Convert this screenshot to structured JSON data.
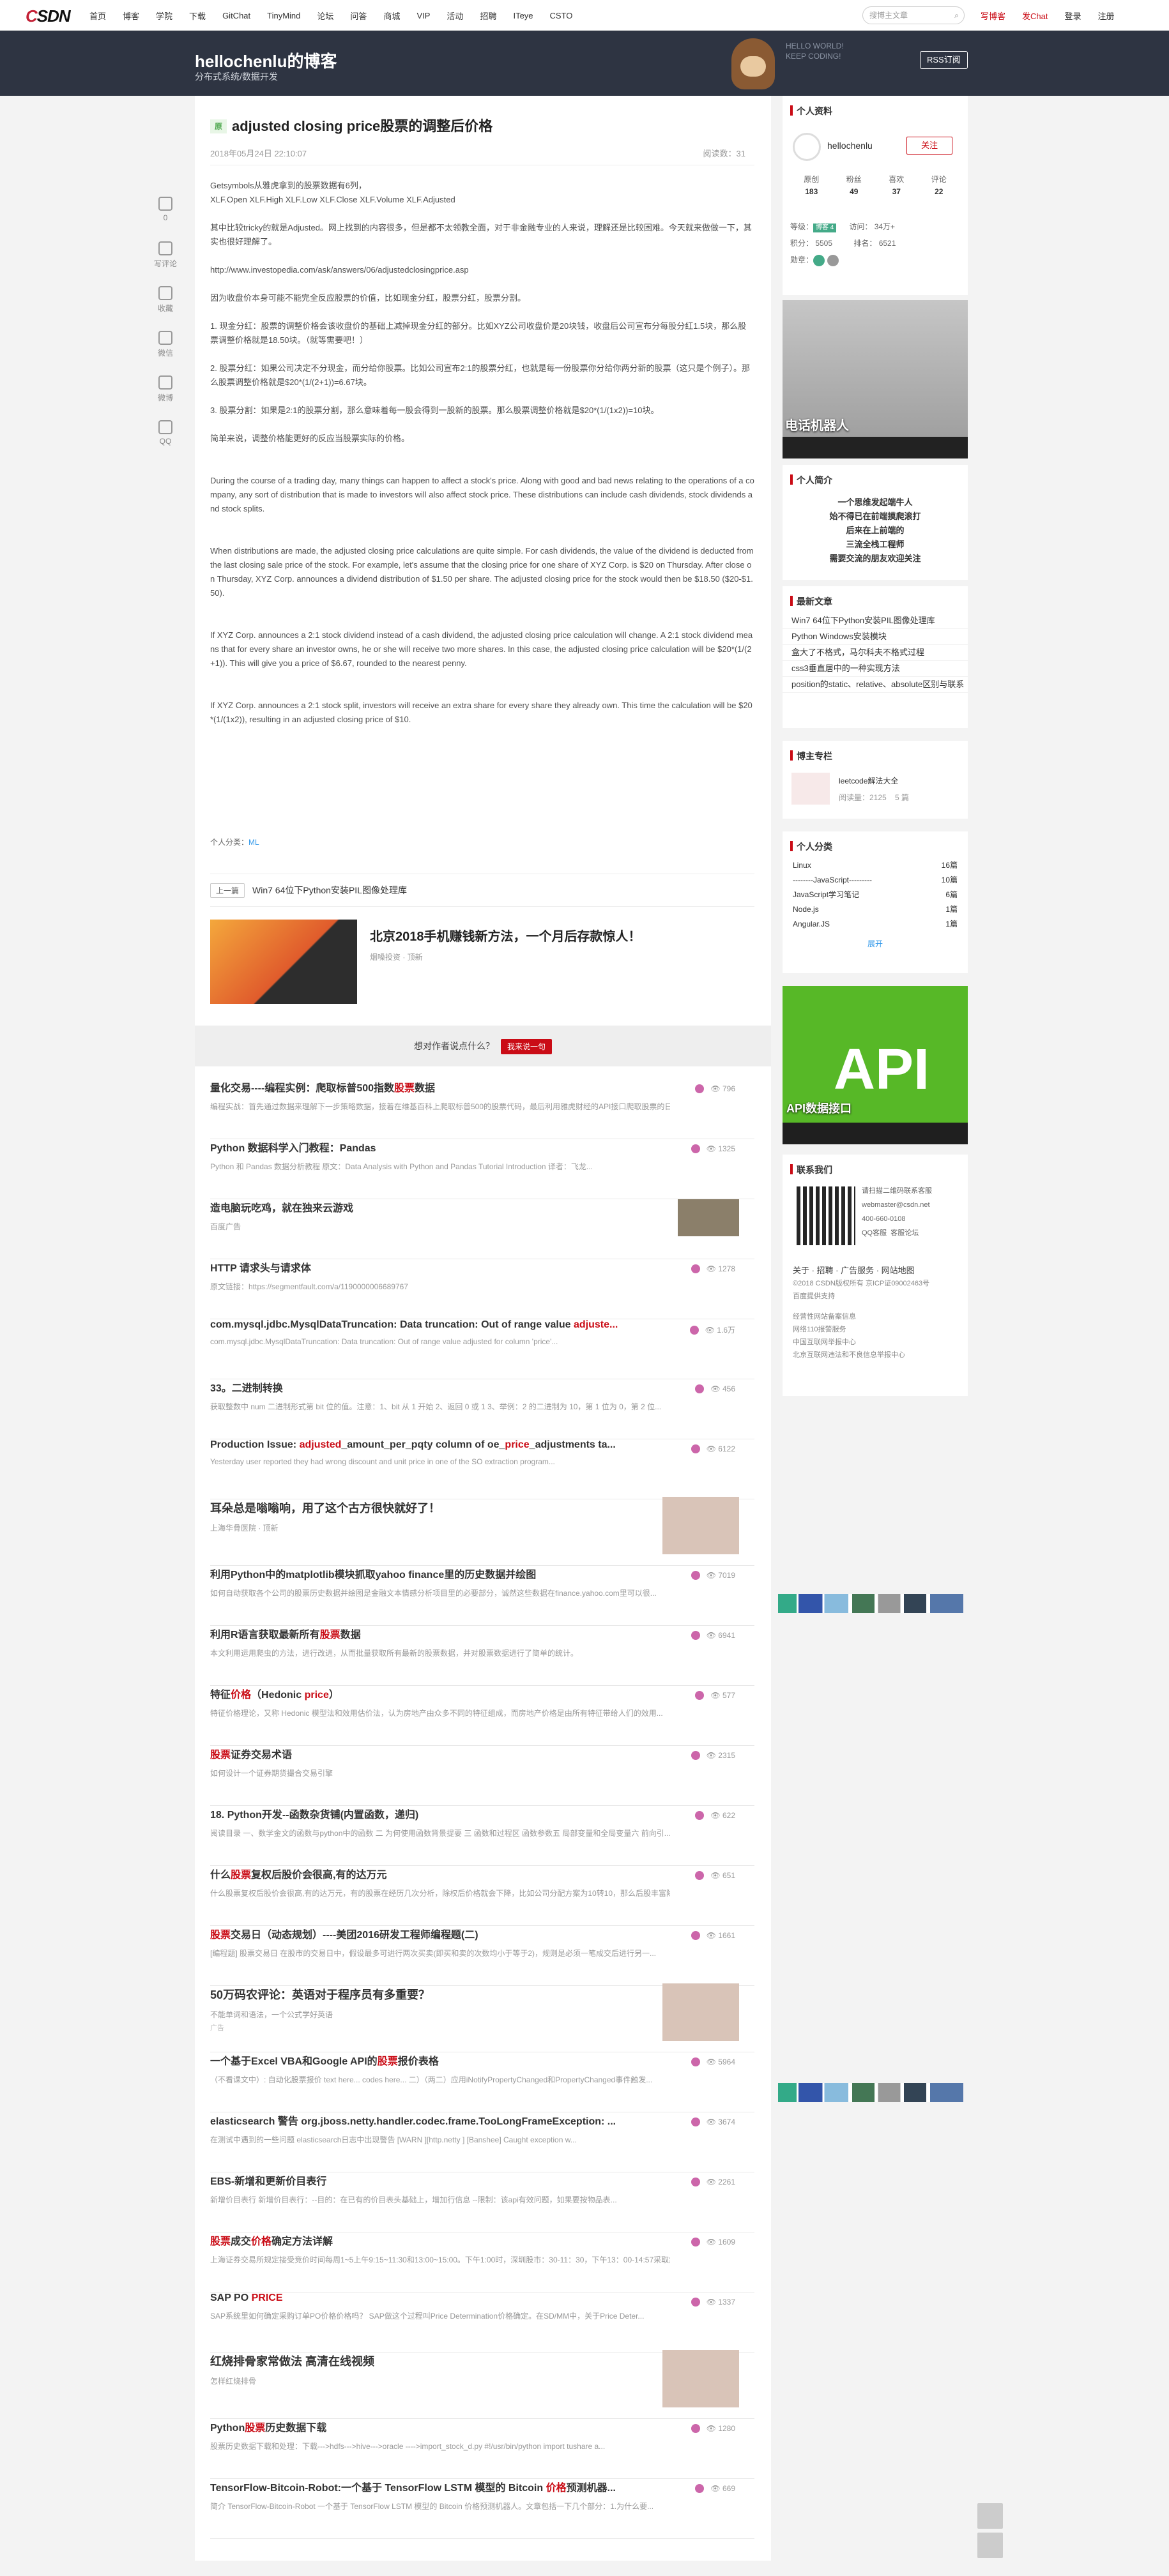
{
  "topnav": {
    "logo_c": "C",
    "logo_rest": "SDN",
    "items": [
      "首页",
      "博客",
      "学院",
      "下载",
      "GitChat",
      "TinyMind",
      "论坛",
      "问答",
      "商城",
      "VIP",
      "活动",
      "招聘",
      "ITeye",
      "CSTO"
    ],
    "search_placeholder": "搜博主文章",
    "write": "写博客",
    "chat": "发Chat",
    "login": "登录",
    "register": "注册"
  },
  "banner": {
    "title": "hellochenlu的博客",
    "subtitle": "分布式系统/数据开发",
    "hello1": "HELLO WORLD!",
    "hello2": "KEEP CODING!",
    "rss": "RSS订阅"
  },
  "side_tools": [
    "点赞",
    "写评论",
    "收藏",
    "微信",
    "微博",
    "QQ"
  ],
  "side_tools_count": "0",
  "article": {
    "badge": "原",
    "title": "adjusted closing price股票的调整后价格",
    "date": "2018年05月24日 22:10:07",
    "reads": "阅读数：31",
    "paragraphs": [
      "Getsymbols从雅虎拿到的股票数据有6列，\n XLF.Open XLF.High  XLF.Low XLF.Close XLF.Volume XLF.Adjusted",
      "其中比较tricky的就是Adjusted。网上找到的内容很多，但是都不太领教全面，对于非金融专业的人来说，理解还是比较困难。今天就来做做一下，其实也很好理解了。",
      "http://www.investopedia.com/ask/answers/06/adjustedclosingprice.asp",
      "因为收盘价本身可能不能完全反应股票的价值，比如现金分红，股票分红，股票分割。",
      "1. 现金分红：股票的调整价格会该收盘价的基础上减掉现金分红的部分。比如XYZ公司收盘价是20块钱，收盘后公司宣布分每股分红1.5块，那么股票调整价格就是18.50块。（就等需要吧！）",
      "2. 股票分红：如果公司决定不分现金，而分给你股票。比如公司宣布2:1的股票分红，也就是每一份股票你分给你两分新的股票（这只是个例子）。那么股票调整价格就是$20*(1/(2+1))=6.67块。",
      "3. 股票分割：如果是2:1的股票分割，那么意味着每一股会得到一股新的股票。那么股票调整价格就是$20*(1/(1x2))=10块。",
      "简单来说，调整价格能更好的反应当股票实际的价格。",
      "During the course of a trading day, many things can happen to affect a stock's price. Along with good and bad news relating to the operations of a company, any sort of distribution that is made to investors will also affect stock price. These distributions can include cash dividends, stock dividends and stock splits.",
      "When distributions are made, the adjusted closing price calculations are quite simple. For cash dividends, the value of the dividend is deducted from the last closing sale price of the stock. For example, let's assume that the closing price for one share of XYZ Corp. is $20 on Thursday. After close on Thursday, XYZ Corp. announces a dividend distribution of $1.50 per share. The adjusted closing price for the stock would then be $18.50 ($20-$1.50).",
      "If XYZ Corp. announces a 2:1 stock dividend instead of a cash dividend, the adjusted closing price calculation will change. A 2:1 stock dividend means that for every share an investor owns, he or she will receive two more shares. In this case, the adjusted closing price calculation will be $20*(1/(2+1)). This will give you a price of $6.67, rounded to the nearest penny.",
      "If XYZ Corp. announces a 2:1 stock split, investors will receive an extra share for every share they already own. This time the calculation will be $20*(1/(1x2)), resulting in an adjusted closing price of $10."
    ],
    "tags_label": "个人分类：",
    "tag": "ML",
    "prev_label": "上一篇",
    "prev_title": "Win7 64位下Python安装PIL图像处理库"
  },
  "ad": {
    "title": "北京2018手机赚钱新方法，一个月后存款惊人！",
    "source": "烟嗓投资 · 顶新"
  },
  "ask": {
    "text": "想对作者说点什么？",
    "button": "我来说一句"
  },
  "recs": [
    {
      "t1": "量化交易----编程实例：爬取标普500指数",
      "em": "股票",
      "t2": "数据",
      "desc": "编程实战：首先通过数据来理解下一步策略数据，接着在维基百科上爬取标普500的股票代码，最后利用雅虎财经的API接口爬取股票的日...",
      "meta": "796"
    },
    {
      "t1": "Python 数据科学入门教程：Pandas",
      "desc": "Python 和 Pandas 数据分析教程 原文：Data Analysis with Python and Pandas Tutorial Introduction 译者：飞龙...",
      "meta": "1325"
    },
    {
      "t1": "造电脑玩吃鸡，就在独来云游戏",
      "desc": "百度广告",
      "ad": true
    },
    {
      "t1": "HTTP 请求头与请求体",
      "desc": "原文链接：https://segmentfault.com/a/1190000006689767",
      "meta": "1278"
    },
    {
      "t1": "com.mysql.jdbc.MysqlDataTruncation: Data truncation: Out of range value ",
      "em": "adjuste...",
      "desc": "com.mysql.jdbc.MysqlDataTruncation: Data truncation: Out of range value adjusted for column 'price'...",
      "meta": "1.6万"
    },
    {
      "t1": "33。二进制转换",
      "desc": "获取整数中 num 二进制形式第 bit 位的值。注意：1、bit 从 1 开始 2、返回 0 或 1 3、举例：2 的二进制为 10，第 1 位为 0，第 2 位...",
      "meta": "456"
    },
    {
      "t1": "Production Issue: ",
      "em": "adjusted",
      "t2": "_amount_per_pqty column of oe_",
      "em2": "price",
      "t3": "_adjustments ta...",
      "desc": "Yesterday user reported they had wrong discount and unit price in one of the SO extraction program...",
      "meta": "6122"
    },
    {
      "t1": "耳朵总是嗡嗡响，用了这个古方很快就好了！",
      "desc": "上海华骨医院 · 顶新",
      "ad": true,
      "big": true
    },
    {
      "t1": "利用Python中的matplotlib模块抓取yahoo finance里的历史数据并绘图",
      "desc": "如何自动获取各个公司的股票历史数据并绘图是金融文本情感分析项目里的必要部分，诚然这些数据在finance.yahoo.com里可以很...",
      "meta": "7019"
    },
    {
      "t1": "利用R语言获取最新所有",
      "em": "股票",
      "t2": "数据",
      "desc": "本文利用运用爬虫的方法，进行改进，从而批量获取所有最新的股票数据，并对股票数据进行了简单的统计。",
      "meta": "6941"
    },
    {
      "t1": "特征",
      "em": "价格",
      "t2": "（Hedonic ",
      "em2": "price",
      "t3": "）",
      "desc": "特征价格理论，又称 Hedonic 模型法和效用估价法，认为房地产由众多不同的特征组成，而房地产价格是由所有特征带给人们的效用...",
      "meta": "577"
    },
    {
      "em": "股票",
      "t1": "",
      "t2": "证券交易术语",
      "desc": "如何设计一个证券期货撮合交易引擎",
      "meta": "2315"
    },
    {
      "t1": "18. Python开发--函数杂货铺(内置函数，递归)",
      "desc": "阅读目录 一、数学金文的函数与python中的函数 二 为何使用函数背景提要 三 函数和过程区 函数参数五 局部变量和全局变量六 前向引...",
      "meta": "622"
    },
    {
      "t1": "什么",
      "em": "股票",
      "t2": "复权后股价会很高,有的达万元",
      "desc": "什么股票复权后股价会很高,有的达万元，有的股票在经历几次分析，除权后价格就会下降，比如公司分配方案为10转10，那么后股丰富除...",
      "meta": "651"
    },
    {
      "em": "股票",
      "t1": "",
      "t2": "交易日（动态规划）----美团2016研发工程师编程题(二)",
      "desc": "[编程题] 股票交易日 在股市的交易日中，假设最多可进行两次买卖(即买和卖的次数均小于等于2)，规则是必须一笔成交后进行另一...",
      "meta": "1661"
    },
    {
      "t1": "50万码农评论：英语对于程序员有多重要？",
      "desc": "不能单词和语法，一个公式学好英语",
      "ad": true,
      "big": true,
      "sub": "广告"
    },
    {
      "t1": "一个基于Excel VBA和Google API的",
      "em": "股票",
      "t2": "报价表格",
      "desc": "（不看课文中）: 自动化股票报价 text here... codes here... 二）（两二）应用iNotifyPropertyChanged和PropertyChanged事件触发...",
      "meta": "5964"
    },
    {
      "t1": "elasticsearch 警告 org.jboss.netty.handler.codec.frame.TooLongFrameException: ...",
      "desc": "在测试中遇到的一些问题 elasticsearch日志中出现警告 [WARN ][http.netty ] [Banshee] Caught exception w...",
      "meta": "3674"
    },
    {
      "t1": "EBS-新增和更新价目表行",
      "desc": "新增价目表行 新增价目表行：--目的：在已有的价目表头基础上，增加行信息 --限制：该api有效问题，如果要按物品表...",
      "meta": "2261"
    },
    {
      "em": "股票",
      "t1": "",
      "t2": "成交",
      "em2": "价格",
      "t3": "确定方法详解",
      "desc": "上海证券交易所规定接受竞价时间每周1~5上午9:15~11:30和13:00~15:00。下午1:00时，深圳股市：30-11：30，下午13：00-14:57采取集...",
      "meta": "1609"
    },
    {
      "t1": "SAP PO ",
      "em": "PRICE",
      "desc": "SAP系统里如何确定采购订单PO价格价格吗？ SAP做这个过程叫Price Determination价格确定。在SD/MM中，关于Price Deter...",
      "meta": "1337"
    },
    {
      "t1": "红烧排骨家常做法 高清在线视频",
      "desc": "怎样红烧排骨",
      "ad": true,
      "big": true
    },
    {
      "t1": "Python",
      "em": "股票",
      "t2": "历史数据下载",
      "desc": "股票历史数据下载和处理：下载--->hdfs--->hive--->oracle ---->import_stock_d.py #!/usr/bin/python import tushare a...",
      "meta": "1280"
    },
    {
      "t1": "TensorFlow-Bitcoin-Robot:一个基于 TensorFlow LSTM 模型的 Bitcoin ",
      "em": "价格",
      "t2": "预测机器...",
      "desc": "简介 TensorFlow-Bitcoin-Robot 一个基于 TensorFlow LSTM 模型的 Bitcoin 价格预测机器人。文章包括一下几个部分：1.为什么要...",
      "meta": "669"
    }
  ],
  "sidebar": {
    "profile_title": "个人资料",
    "username": "hellochenlu",
    "follow": "关注",
    "stats": [
      {
        "label": "原创",
        "value": "183"
      },
      {
        "label": "粉丝",
        "value": "49"
      },
      {
        "label": "喜欢",
        "value": "37"
      },
      {
        "label": "评论",
        "value": "22"
      }
    ],
    "grade_label": "等级：",
    "level": "博客 4",
    "visits": "访问：  34万+",
    "points": "积分：  5505",
    "rank": "排名：  6521",
    "medals": "勋章：",
    "robot_caption": "电话机器人",
    "intro_title": "个人简介",
    "intro_lines": [
      "一个思维发起端牛人",
      "始不得已在前端摸爬滚打",
      "后来在上前端的",
      "三流全栈工程师",
      "需要交流的朋友欢迎关注"
    ],
    "recent_title": "最新文章",
    "recent": [
      "Win7 64位下Python安装PIL图像处理库",
      "Python Windows安装模块",
      "盒大了不格式，马尔科夫不格式过程",
      "css3垂直居中的一种实现方法",
      "position的static、relative、absolute区别与联系"
    ],
    "column_title": "博主专栏",
    "column_name": "leetcode解法大全",
    "column_reads": "阅读量：2125",
    "column_count": "5 篇",
    "cat_title": "个人分类",
    "cats": [
      {
        "n": "Linux",
        "c": "16篇"
      },
      {
        "n": "--------JavaScript---------",
        "c": "10篇"
      },
      {
        "n": "JavaScript学习笔记",
        "c": "6篇"
      },
      {
        "n": "Node.js",
        "c": "1篇"
      },
      {
        "n": "Angular.JS",
        "c": "1篇"
      }
    ],
    "cat_more": "展开",
    "api_caption": "API数据接口",
    "api_word": "API",
    "contact_title": "联系我们",
    "qr_label": "请扫描二维码联系客服",
    "email": "webmaster@csdn.net",
    "phone": "400-660-0108",
    "qq": "QQ客服",
    "kefu": "客服论坛",
    "about": "关于 · 招聘 · 广告服务 · 网站地图",
    "copyright": "©2018 CSDN版权所有 京ICP证09002463号",
    "baidu": "百度提供支持",
    "legal": [
      "经营性网站备案信息",
      "网络110报警服务",
      "中国互联网举报中心",
      "北京互联网违法和不良信息举报中心"
    ]
  }
}
